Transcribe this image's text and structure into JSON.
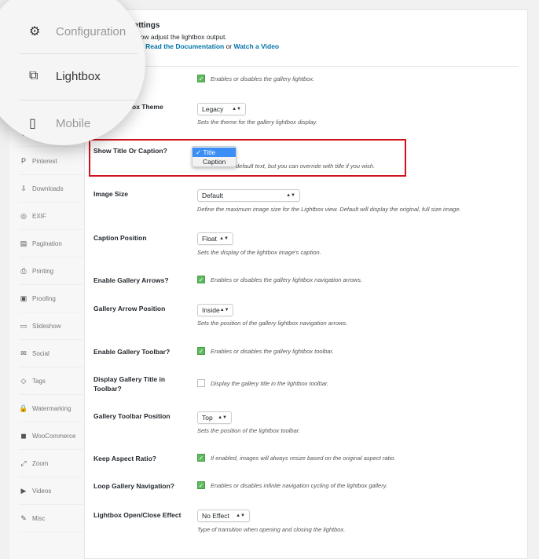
{
  "header": {
    "title": "Settings",
    "intro": "elow adjust the lightbox output.",
    "help_prefix": "? ",
    "doc_link": "Read the Documentation",
    "or": " or ",
    "video_link": "Watch a Video"
  },
  "magnifier": {
    "items": [
      {
        "label": "Configuration",
        "icon": "gears-icon"
      },
      {
        "label": "Lightbox",
        "icon": "lightbox-icon"
      },
      {
        "label": "Mobile",
        "icon": "mobile-icon"
      }
    ]
  },
  "sidebar": {
    "items": [
      {
        "label": "Pinterest",
        "icon": "P"
      },
      {
        "label": "Downloads",
        "icon": "⇩"
      },
      {
        "label": "EXIF",
        "icon": "◎"
      },
      {
        "label": "Pagination",
        "icon": "▤"
      },
      {
        "label": "Printing",
        "icon": "⎙"
      },
      {
        "label": "Proofing",
        "icon": "▣"
      },
      {
        "label": "Slideshow",
        "icon": "▭"
      },
      {
        "label": "Social",
        "icon": "✉"
      },
      {
        "label": "Tags",
        "icon": "◇"
      },
      {
        "label": "Watermarking",
        "icon": "🔒"
      },
      {
        "label": "WooCommerce",
        "icon": "◼"
      },
      {
        "label": "Zoom",
        "icon": "⤢"
      },
      {
        "label": "Videos",
        "icon": "▶"
      },
      {
        "label": "Misc",
        "icon": "✎"
      }
    ]
  },
  "settings": {
    "enable_lightbox": {
      "label": "?",
      "desc": "Enables or disables the gallery lightbox.",
      "checked": true
    },
    "theme": {
      "label": "ox Theme",
      "value": "Legacy",
      "desc": "Sets the theme for the gallery lightbox display."
    },
    "title_caption": {
      "label": "Show Title Or Caption?",
      "options": [
        "Title",
        "Caption"
      ],
      "selected": "Title",
      "desc": "default text, but you can override with title if you wish."
    },
    "image_size": {
      "label": "Image Size",
      "value": "Default",
      "desc": "Define the maximum image size for the Lightbox view. Default will display the original, full size image."
    },
    "caption_position": {
      "label": "Caption Position",
      "value": "Float",
      "desc": "Sets the display of the lightbox image's caption."
    },
    "arrows": {
      "label": "Enable Gallery Arrows?",
      "desc": "Enables or disables the gallery lightbox navigation arrows.",
      "checked": true
    },
    "arrow_position": {
      "label": "Gallery Arrow Position",
      "value": "Inside",
      "desc": "Sets the position of the gallery lightbox navigation arrows."
    },
    "toolbar": {
      "label": "Enable Gallery Toolbar?",
      "desc": "Enables or disables the gallery lightbox toolbar.",
      "checked": true
    },
    "toolbar_title": {
      "label": "Display Gallery Title in Toolbar?",
      "desc": "Display the gallery title in the lightbox toolbar.",
      "checked": false
    },
    "toolbar_position": {
      "label": "Gallery Toolbar Position",
      "value": "Top",
      "desc": "Sets the position of the lightbox toolbar."
    },
    "aspect": {
      "label": "Keep Aspect Ratio?",
      "desc": "If enabled, images will always resize based on the original aspect ratio.",
      "checked": true
    },
    "loop": {
      "label": "Loop Gallery Navigation?",
      "desc": "Enables or disables infinite navigation cycling of the lightbox gallery.",
      "checked": true
    },
    "effect": {
      "label": "Lightbox Open/Close Effect",
      "value": "No Effect",
      "desc": "Type of transition when opening and closing the lightbox."
    }
  },
  "colors": {
    "highlight_box": "#d0121b",
    "checkbox": "#5fb95f",
    "link": "#0073aa",
    "dropdown_highlight": "#3b8ef5"
  }
}
